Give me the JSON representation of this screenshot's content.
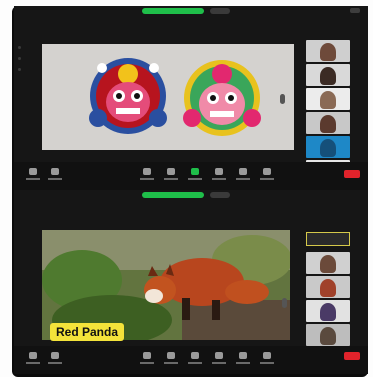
{
  "top_window": {
    "meeting_timer": "",
    "recording_label": "",
    "toolbar_buttons": [
      "mute",
      "video",
      "security",
      "participants",
      "chat",
      "share",
      "record",
      "reactions",
      "more"
    ],
    "end_button": "End"
  },
  "bottom_window": {
    "share_label": "Red Panda",
    "speaker_name": "",
    "toolbar_buttons": [
      "mute",
      "video",
      "security",
      "participants",
      "chat",
      "share",
      "record",
      "reactions",
      "more"
    ],
    "end_button": "End"
  },
  "colors": {
    "accent_green": "#1fbf4a",
    "end_red": "#e0232b",
    "label_yellow": "#f4e33a",
    "speaker_border": "#d5c94a"
  }
}
